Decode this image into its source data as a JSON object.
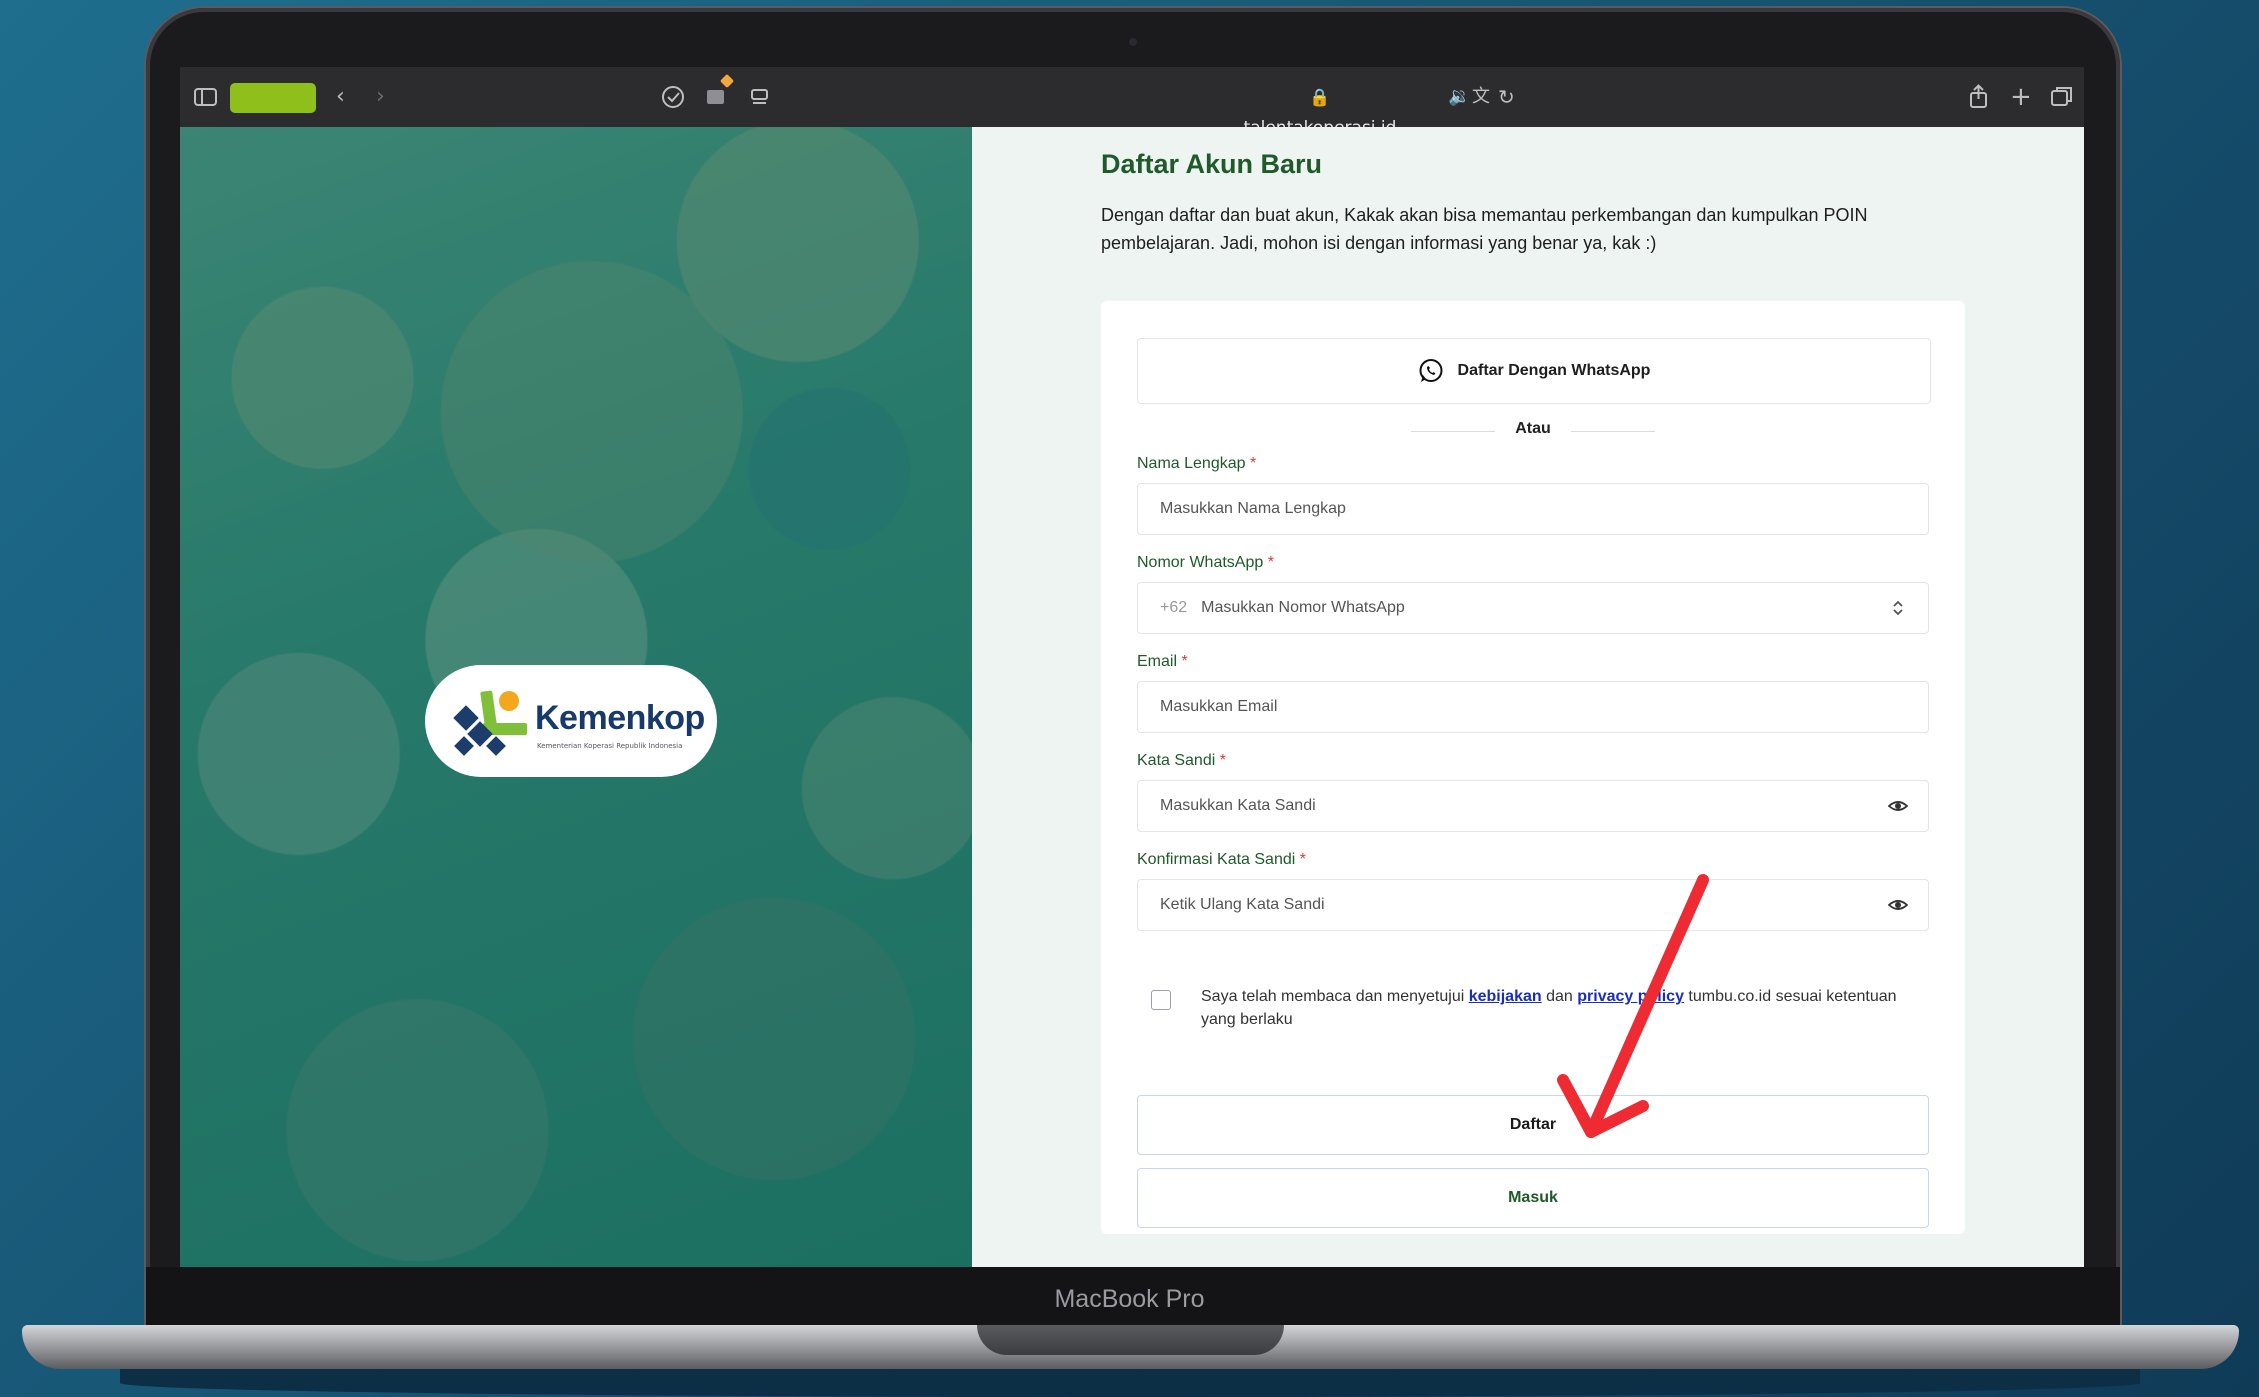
{
  "device": {
    "label": "MacBook Pro"
  },
  "browser": {
    "url": "talentakoperasi.id",
    "icons": [
      "sidebar-icon",
      "back-icon",
      "forward-icon",
      "checkmark-icon",
      "extension-icon",
      "reader-icon",
      "lock-icon",
      "audio-icon",
      "translate-icon",
      "reload-icon",
      "share-icon",
      "new-tab-icon",
      "tabs-overview-icon"
    ]
  },
  "brand": {
    "name": "Kemenkop",
    "subtitle": "Kementerian Koperasi Republik Indonesia"
  },
  "page": {
    "title": "Daftar Akun Baru",
    "description": "Dengan daftar dan buat akun, Kakak akan bisa memantau perkembangan dan kumpulkan POIN pembelajaran. Jadi, mohon isi dengan informasi yang benar ya, kak :)"
  },
  "form": {
    "whatsapp_button": "Daftar Dengan WhatsApp",
    "divider": "Atau",
    "fields": {
      "name": {
        "label": "Nama Lengkap",
        "placeholder": "Masukkan Nama Lengkap"
      },
      "phone": {
        "label": "Nomor WhatsApp",
        "prefix": "+62",
        "placeholder": "Masukkan Nomor WhatsApp"
      },
      "email": {
        "label": "Email",
        "placeholder": "Masukkan Email"
      },
      "password": {
        "label": "Kata Sandi",
        "placeholder": "Masukkan Kata Sandi"
      },
      "confirm": {
        "label": "Konfirmasi Kata Sandi",
        "placeholder": "Ketik Ulang Kata Sandi"
      }
    },
    "required_mark": "*",
    "agreement": {
      "before": "Saya telah membaca dan menyetujui ",
      "link1": "kebijakan",
      "middle": " dan ",
      "link2": "privacy policy",
      "after": " tumbu.co.id sesuai ketentuan yang berlaku"
    },
    "register_button": "Daftar",
    "login_button": "Masuk"
  },
  "colors": {
    "accent_green": "#1f5a2a",
    "required": "#d43c3c",
    "link": "#1a2fb8",
    "annotation_arrow": "#ee2a32",
    "tab_pill": "#8fbf1a"
  }
}
